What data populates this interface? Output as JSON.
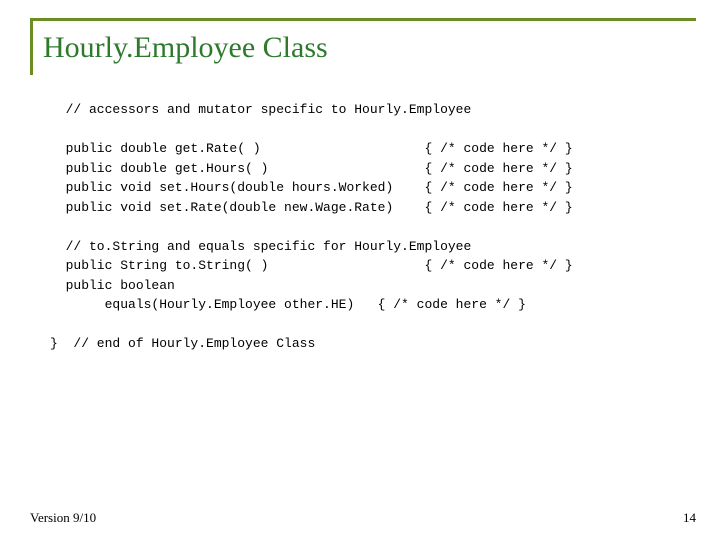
{
  "title": "Hourly.Employee Class",
  "code": "  // accessors and mutator specific to Hourly.Employee\n\n  public double get.Rate( )                     { /* code here */ }\n  public double get.Hours( )                    { /* code here */ }\n  public void set.Hours(double hours.Worked)    { /* code here */ }\n  public void set.Rate(double new.Wage.Rate)    { /* code here */ }\n\n  // to.String and equals specific for Hourly.Employee\n  public String to.String( )                    { /* code here */ }\n  public boolean\n       equals(Hourly.Employee other.HE)   { /* code here */ }\n\n}  // end of Hourly.Employee Class",
  "footer": {
    "version": "Version 9/10",
    "page": "14"
  }
}
